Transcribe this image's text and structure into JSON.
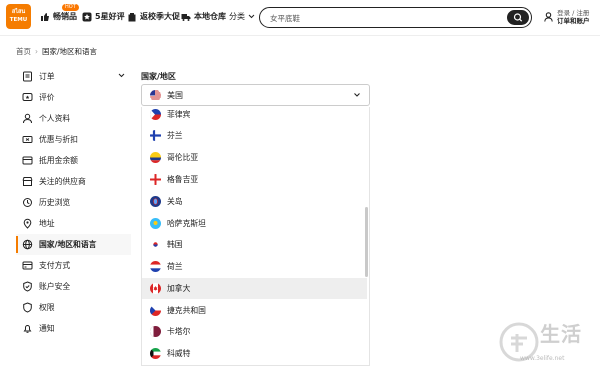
{
  "header": {
    "logo_line1": "สไสน",
    "logo_line2": "TEMU",
    "hot_badge": "HOT",
    "nav": [
      {
        "label": "畅销品",
        "icon": "thumbs-up-icon"
      },
      {
        "label": "5星好评",
        "icon": "star-icon"
      },
      {
        "label": "返校季大促",
        "icon": "backpack-icon"
      },
      {
        "label": "本地仓库",
        "icon": "truck-icon"
      },
      {
        "label": "分类",
        "icon": "chevron-down-icon"
      }
    ],
    "search_value": "女平底鞋",
    "account_line1": "登录 / 注册",
    "account_line2": "订单和账户"
  },
  "breadcrumb": {
    "home": "首页",
    "current": "国家/地区和语言"
  },
  "sidebar": {
    "items": [
      {
        "label": "订单",
        "icon": "order-icon"
      },
      {
        "label": "评价",
        "icon": "review-icon"
      },
      {
        "label": "个人资料",
        "icon": "profile-icon"
      },
      {
        "label": "优惠与折扣",
        "icon": "coupon-icon"
      },
      {
        "label": "抵用金余额",
        "icon": "credit-icon"
      },
      {
        "label": "关注的供应商",
        "icon": "store-icon"
      },
      {
        "label": "历史浏览",
        "icon": "history-icon"
      },
      {
        "label": "地址",
        "icon": "location-icon"
      },
      {
        "label": "国家/地区和语言",
        "icon": "globe-icon"
      },
      {
        "label": "支付方式",
        "icon": "payment-icon"
      },
      {
        "label": "账户安全",
        "icon": "shield-icon"
      },
      {
        "label": "权限",
        "icon": "permission-icon"
      },
      {
        "label": "通知",
        "icon": "bell-icon"
      }
    ],
    "active_index": 8
  },
  "main": {
    "label": "国家/地区",
    "selected": "美国",
    "options": [
      "菲律宾",
      "芬兰",
      "哥伦比亚",
      "格鲁吉亚",
      "关岛",
      "哈萨克斯坦",
      "韩国",
      "荷兰",
      "加拿大",
      "捷克共和国",
      "卡塔尔",
      "科威特"
    ],
    "highlighted_index": 8
  },
  "watermark": {
    "text": "生活",
    "url": "www.3elife.net"
  }
}
